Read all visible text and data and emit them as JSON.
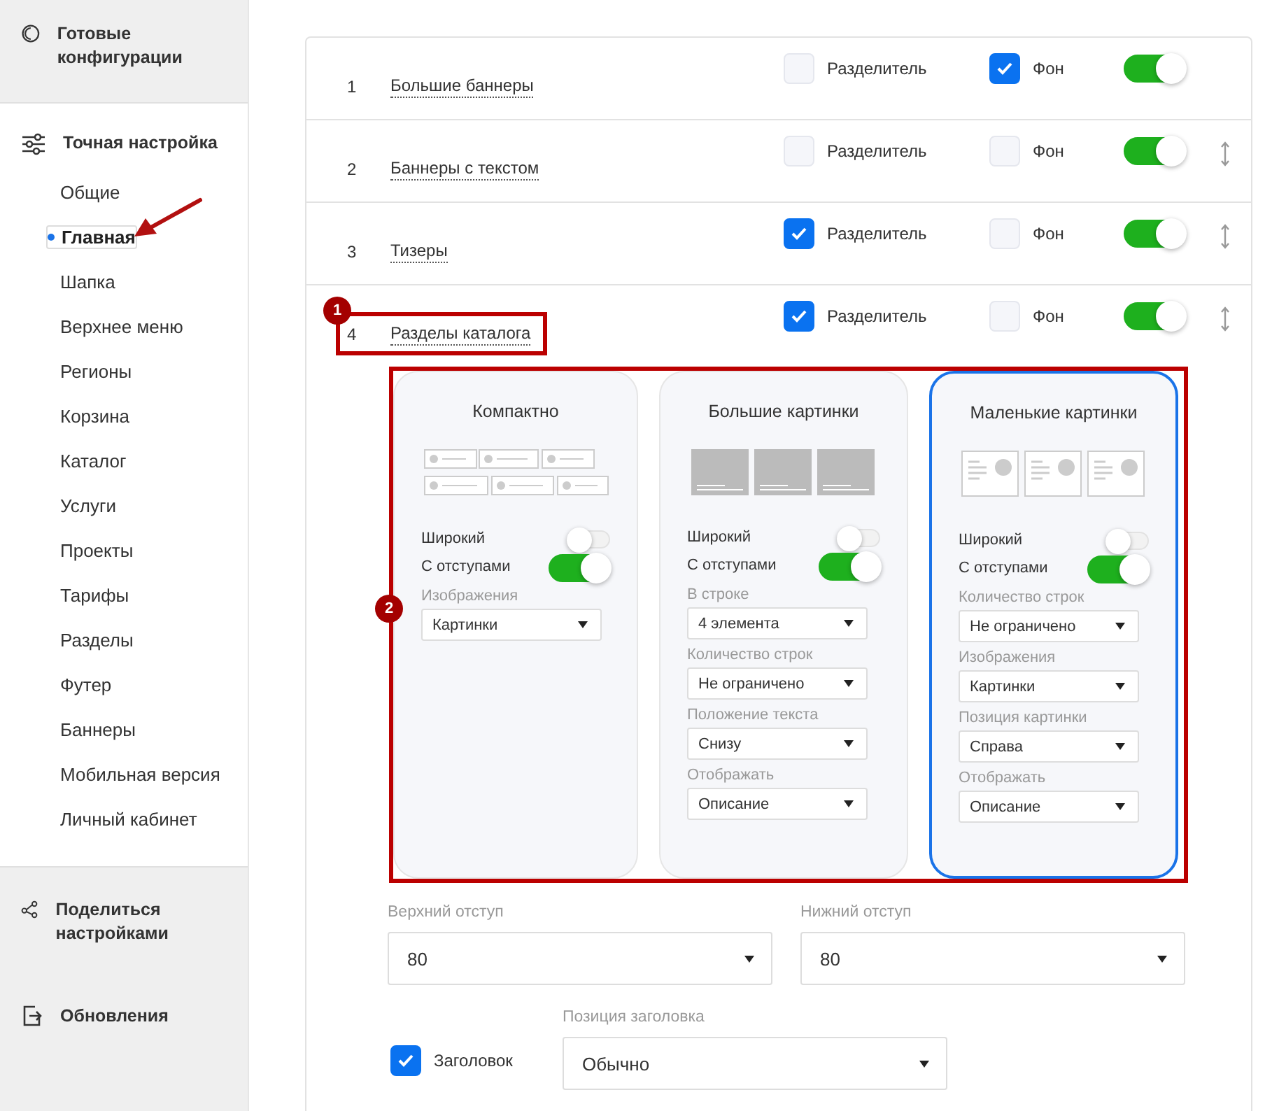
{
  "sidebar": {
    "sections": [
      {
        "kind": "presets",
        "label": "Готовые конфигурации"
      },
      {
        "kind": "tuning",
        "label": "Точная настройка",
        "items": [
          {
            "label": "Общие",
            "selected": false,
            "pointer": false
          },
          {
            "label": "Главная",
            "selected": true,
            "pointer": true
          },
          {
            "label": "Шапка",
            "selected": false,
            "pointer": false
          },
          {
            "label": "Верхнее меню",
            "selected": false,
            "pointer": false
          },
          {
            "label": "Регионы",
            "selected": false,
            "pointer": false
          },
          {
            "label": "Корзина",
            "selected": false,
            "pointer": false
          },
          {
            "label": "Каталог",
            "selected": false,
            "pointer": false
          },
          {
            "label": "Услуги",
            "selected": false,
            "pointer": false
          },
          {
            "label": "Проекты",
            "selected": false,
            "pointer": false
          },
          {
            "label": "Тарифы",
            "selected": false,
            "pointer": false
          },
          {
            "label": "Разделы",
            "selected": false,
            "pointer": false
          },
          {
            "label": "Футер",
            "selected": false,
            "pointer": false
          },
          {
            "label": "Баннеры",
            "selected": false,
            "pointer": false
          },
          {
            "label": "Мобильная версия",
            "selected": false,
            "pointer": false
          },
          {
            "label": "Личный кабинет",
            "selected": false,
            "pointer": false
          }
        ]
      },
      {
        "kind": "share",
        "label": "Поделиться настройками"
      },
      {
        "kind": "updates",
        "label": "Обновления"
      }
    ]
  },
  "blocks": [
    {
      "number": "1",
      "name": "Большие баннеры",
      "divider": {
        "label": "Разделитель",
        "checked": false
      },
      "background": {
        "label": "Фон",
        "checked": true
      },
      "on": true,
      "draggable": false
    },
    {
      "number": "2",
      "name": "Баннеры с текстом",
      "divider": {
        "label": "Разделитель",
        "checked": false
      },
      "background": {
        "label": "Фон",
        "checked": false
      },
      "on": true,
      "draggable": true
    },
    {
      "number": "3",
      "name": "Тизеры",
      "divider": {
        "label": "Разделитель",
        "checked": true
      },
      "background": {
        "label": "Фон",
        "checked": false
      },
      "on": true,
      "draggable": true
    },
    {
      "number": "4",
      "name": "Разделы каталога",
      "divider": {
        "label": "Разделитель",
        "checked": true
      },
      "background": {
        "label": "Фон",
        "checked": false
      },
      "on": true,
      "draggable": true,
      "callout": "1",
      "settings": {
        "callout": "2",
        "layouts": [
          {
            "kind": "compact",
            "title": "Компактно",
            "selected": false,
            "toggles": [
              {
                "label": "Широкий",
                "on": false
              },
              {
                "label": "С отступами",
                "on": true
              }
            ],
            "selects": [
              {
                "label": "Изображения",
                "value": "Картинки"
              }
            ]
          },
          {
            "kind": "large",
            "title": "Большие картинки",
            "selected": false,
            "toggles": [
              {
                "label": "Широкий",
                "on": false
              },
              {
                "label": "С отступами",
                "on": true
              }
            ],
            "selects": [
              {
                "label": "В строке",
                "value": "4 элемента"
              },
              {
                "label": "Количество строк",
                "value": "Не ограничено"
              },
              {
                "label": "Положение текста",
                "value": "Снизу"
              },
              {
                "label": "Отображать",
                "value": "Описание"
              }
            ]
          },
          {
            "kind": "small",
            "title": "Маленькие картинки",
            "selected": true,
            "toggles": [
              {
                "label": "Широкий",
                "on": false
              },
              {
                "label": "С отступами",
                "on": true
              }
            ],
            "selects": [
              {
                "label": "Количество строк",
                "value": "Не ограничено"
              },
              {
                "label": "Изображения",
                "value": "Картинки"
              },
              {
                "label": "Позиция картинки",
                "value": "Справа"
              },
              {
                "label": "Отображать",
                "value": "Описание"
              }
            ]
          }
        ],
        "margins": [
          {
            "label": "Верхний отступ",
            "value": "80"
          },
          {
            "label": "Нижний отступ",
            "value": "80"
          }
        ],
        "heading": {
          "label": "Заголовок",
          "checked": true
        },
        "heading_position": {
          "label": "Позиция заголовка",
          "value": "Обычно"
        }
      }
    }
  ]
}
